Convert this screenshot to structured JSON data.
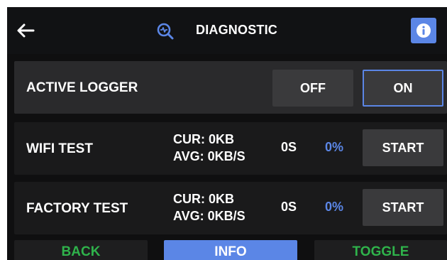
{
  "header": {
    "title": "DIAGNOSTIC",
    "back_icon": "arrow-left-icon",
    "title_icon": "magnifier-pulse-icon",
    "info_icon": "info-icon"
  },
  "rows": {
    "active_logger": {
      "label": "ACTIVE LOGGER",
      "off_label": "OFF",
      "on_label": "ON",
      "selected": "ON"
    },
    "wifi_test": {
      "label": "WIFI TEST",
      "cur": "CUR: 0KB",
      "avg": "AVG: 0KB/S",
      "seconds": "0S",
      "percent": "0%",
      "start_label": "START"
    },
    "factory_test": {
      "label": "FACTORY TEST",
      "cur": "CUR: 0KB",
      "avg": "AVG: 0KB/S",
      "seconds": "0S",
      "percent": "0%",
      "start_label": "START"
    }
  },
  "bottom": {
    "back_label": "BACK",
    "info_label": "INFO",
    "toggle_label": "TOGGLE"
  },
  "colors": {
    "accent": "#5b86e6",
    "green": "#2fb34b",
    "background": "#0f0f10"
  }
}
